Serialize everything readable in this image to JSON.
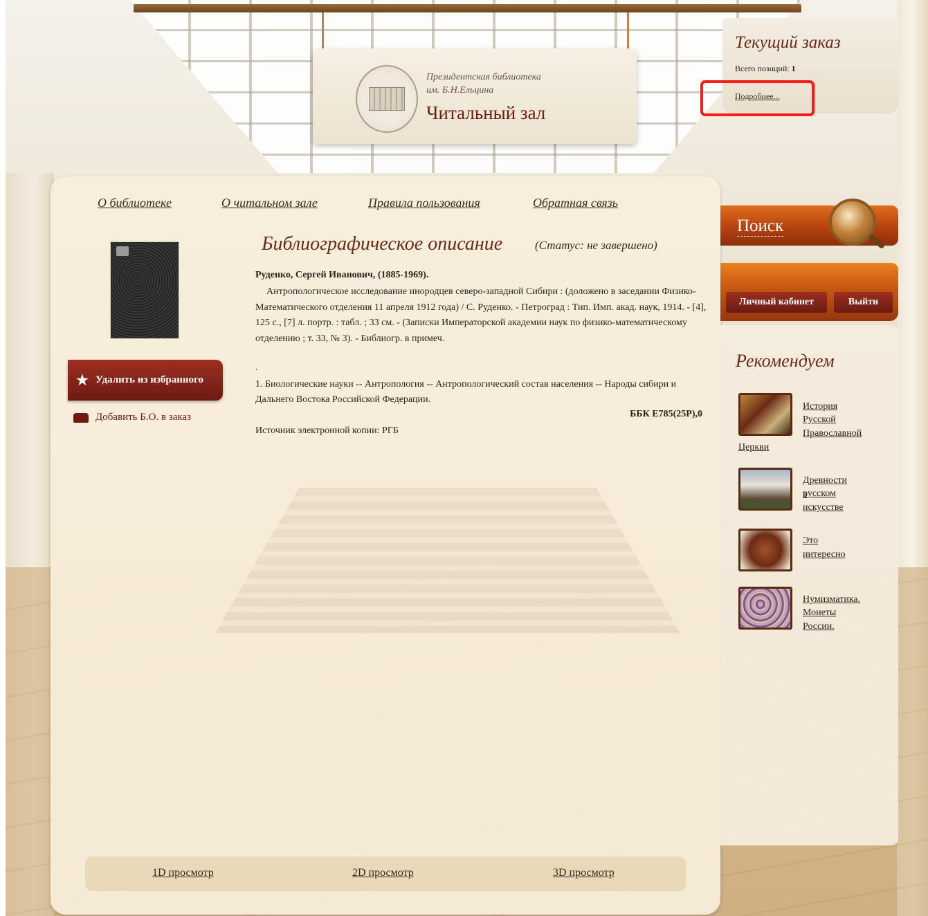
{
  "header": {
    "library_line1": "Президентская библиотека",
    "library_line2": "им. Б.Н.Ельцина",
    "title": "Читальный зал"
  },
  "order": {
    "title": "Текущий заказ",
    "count_label": "Всего позиций:",
    "count_value": "1",
    "more_link": "Подробнее..."
  },
  "nav": {
    "items": [
      {
        "label": "О библиотеке"
      },
      {
        "label": "О читальном зале"
      },
      {
        "label": "Правила пользования"
      },
      {
        "label": "Обратная связь"
      }
    ]
  },
  "actions": {
    "remove_favorite": "Удалить из избранного",
    "add_to_order": "Добавить Б.О. в заказ"
  },
  "record": {
    "heading": "Библиографическое описание",
    "status": "(Статус: не завершено)",
    "author": "Руденко, Сергей Иванович, (1885-1969).",
    "description": "Антропологическое исследование инородцев северо-западной Сибири : (доложено в заседании Физико-Математического отделения 11 апреля 1912 года) / С. Руденко. - Петроград : Тип. Имп. акад. наук, 1914. - [4], 125 с., [7] л. портр. : табл. ; 33 см. - (Записки Императорской академии наук по физико-математическому отделению ; т. 33, № 3). - Библиогр. в примеч.",
    "dot": ".",
    "subject": "1. Биологические науки -- Антропология -- Антропологический состав населения -- Народы сибири и Дальнего Востока Российской Федерации.",
    "bbk": "ББК Е785(25Р),0",
    "source": "Источник электронной копии: РГБ"
  },
  "views": {
    "view_1d": "1D просмотр",
    "view_2d": "2D просмотр",
    "view_3d": "3D просмотр"
  },
  "sidebar": {
    "search_label": "Поиск",
    "cabinet_button": "Личный кабинет",
    "logout_button": "Выйти",
    "recommend_title": "Рекомендуем",
    "recommend_items": [
      {
        "line1": "История",
        "line2": "Русской",
        "line3": "Православной",
        "line4": "Церкви"
      },
      {
        "line1": "Древности в",
        "line2": "русском",
        "line3": "искусстве"
      },
      {
        "line1": "Это интересно"
      },
      {
        "line1": "Нумизматика.",
        "line2": "Монеты России."
      }
    ]
  },
  "colors": {
    "accent_red": "#6e1a12",
    "search_orange": "#c85a12",
    "highlight_box": "#ff1a1a"
  }
}
